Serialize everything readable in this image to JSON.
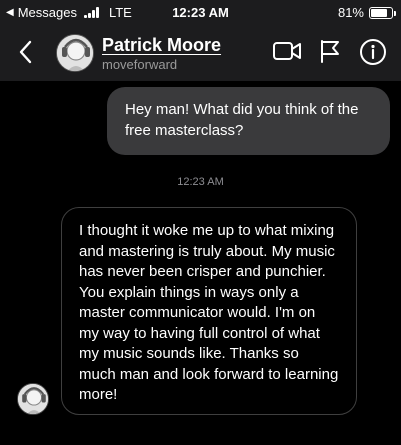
{
  "status_bar": {
    "carrier": "Messages",
    "network": "LTE",
    "time": "12:23 AM",
    "battery_percent": "81%",
    "battery_level": 0.81
  },
  "header": {
    "contact_name": "Patrick Moore",
    "contact_handle": "moveforward",
    "icons": [
      "back-chevron-icon",
      "video-camera-icon",
      "flag-icon",
      "info-icon"
    ]
  },
  "thread": {
    "sent_message": "Hey man! What did you think of the free masterclass?",
    "timestamp": "12:23 AM",
    "received_message": "I thought it woke me up to what mixing and mastering is truly about. My music has never been crisper and punchier. You explain things in ways only a master communicator would. I'm on my way to having full control of what my music sounds like. Thanks so much man and look forward to learning more!"
  },
  "colors": {
    "background": "#000000",
    "header_background": "#1c1c1e",
    "sent_bubble": "#3a3a3c",
    "received_bubble_border": "#3f3f3f",
    "secondary_text": "#9a9a9a"
  }
}
